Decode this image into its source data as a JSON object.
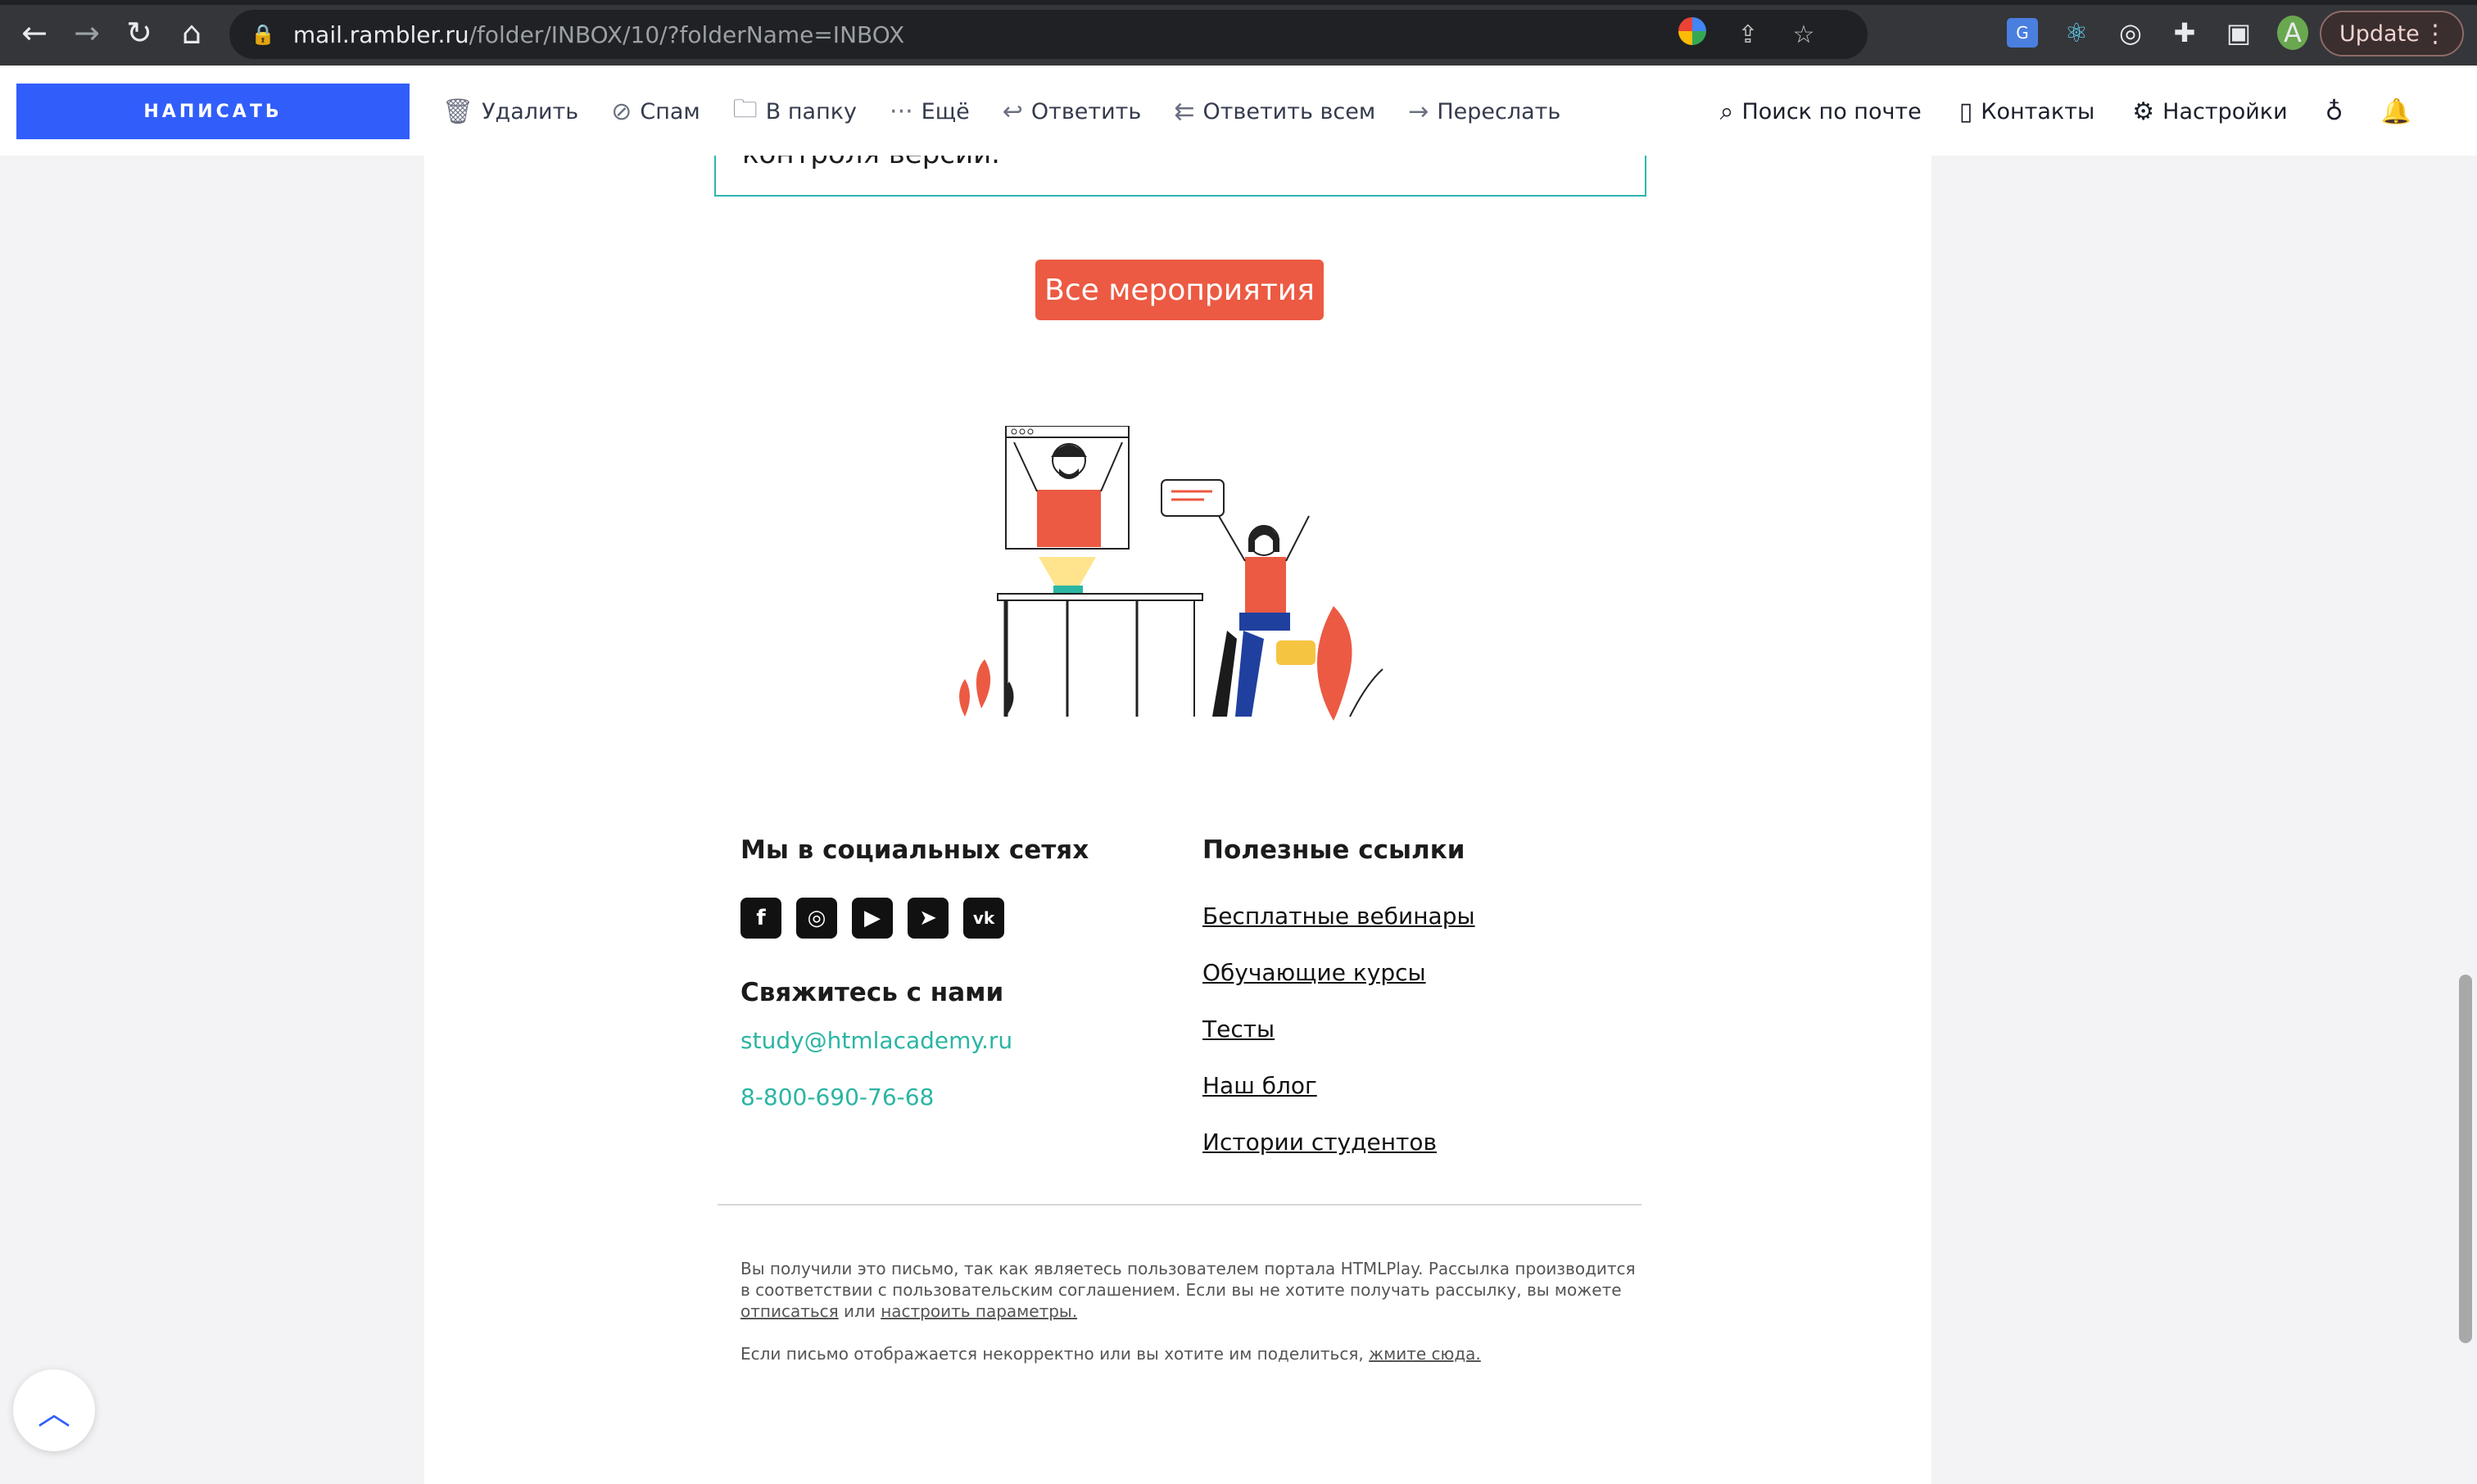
{
  "browser": {
    "url_host": "mail.rambler.ru",
    "url_path": "/folder/INBOX/10/?folderName=INBOX",
    "update_label": "Update",
    "profile_initial": "A"
  },
  "toolbar": {
    "compose_label": "НАПИСАТЬ",
    "actions": [
      {
        "label": "Удалить",
        "icon": "trash-icon"
      },
      {
        "label": "Спам",
        "icon": "spam-icon"
      },
      {
        "label": "В папку",
        "icon": "folder-icon"
      },
      {
        "label": "Ещё",
        "icon": "more-icon"
      },
      {
        "label": "Ответить",
        "icon": "reply-icon"
      },
      {
        "label": "Ответить всем",
        "icon": "reply-all-icon"
      },
      {
        "label": "Переслать",
        "icon": "forward-icon"
      }
    ],
    "right": {
      "search_label": "Поиск по почте",
      "contacts_label": "Контакты",
      "settings_label": "Настройки"
    }
  },
  "letter": {
    "event_text_partial": "контроля версий.",
    "all_events_label": "Все мероприятия",
    "social_title": "Мы в социальных сетях",
    "socials": [
      "facebook",
      "instagram",
      "youtube",
      "telegram",
      "vk"
    ],
    "contact_title": "Свяжитесь с нами",
    "contact_email": "study@htmlacademy.ru",
    "contact_phone": "8-800-690-76-68",
    "useful_title": "Полезные ссылки",
    "useful_links": [
      "Бесплатные вебинары",
      "Обучающие курсы",
      "Тесты",
      "Наш блог",
      "Истории студентов"
    ],
    "footnote_1": "Вы получили это письмо, так как являетесь пользователем портала HTMLPlay. Рассылка производится в соответствии с пользовательским соглашением. Если вы не хотите получать рассылку, вы можете",
    "unsubscribe_label": "отписаться",
    "or_label": "или",
    "settings_link_label": "настроить параметры.",
    "footnote_2": "Если письмо отображается некорректно или вы хотите им поделиться,",
    "press_here_label": "жмите сюда."
  },
  "colors": {
    "accent": "#315efb",
    "event_button": "#ec5a43",
    "teal": "#2bb5a3"
  }
}
